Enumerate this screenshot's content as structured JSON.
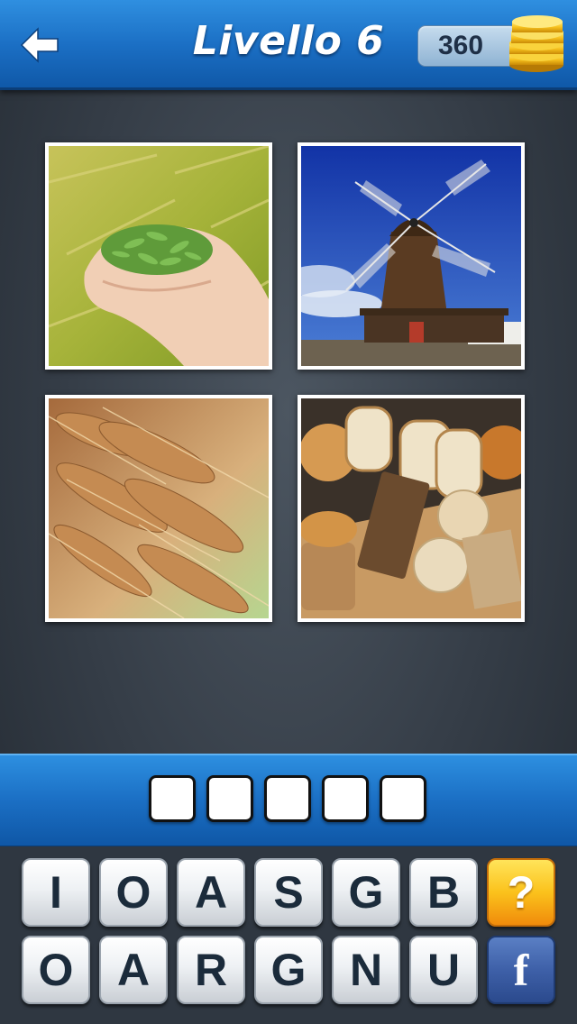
{
  "header": {
    "title": "Livello 6",
    "coins": "360"
  },
  "images": [
    {
      "name": "hands-holding-grain"
    },
    {
      "name": "windmill"
    },
    {
      "name": "wheat-ears"
    },
    {
      "name": "bread-assortment"
    }
  ],
  "answer": {
    "slots": [
      "",
      "",
      "",
      "",
      ""
    ]
  },
  "keyboard": {
    "row1": [
      "I",
      "O",
      "A",
      "S",
      "G",
      "B"
    ],
    "row2": [
      "O",
      "A",
      "R",
      "G",
      "N",
      "U"
    ],
    "hint_label": "?",
    "facebook_label": "f"
  },
  "colors": {
    "bar_blue": "#1b6fc4",
    "hint_orange": "#f08b0b",
    "facebook_blue": "#3e60a8"
  }
}
